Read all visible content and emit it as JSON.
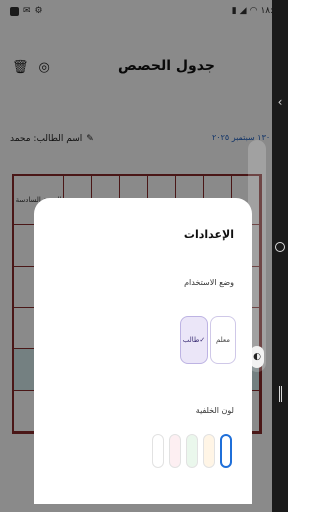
{
  "status_bar": {
    "time": "١٨:٤",
    "left_icons": [
      "media-badge-icon",
      "mail-icon",
      "settings-icon"
    ],
    "right_icons": [
      "battery-icon",
      "signal-icon",
      "wifi-icon"
    ]
  },
  "header": {
    "title": "جدول الحصص",
    "icons": [
      "delete-icon",
      "palette-icon"
    ]
  },
  "student": {
    "label": "اسم الطالب: محمد",
    "edit_icon": "pencil-icon"
  },
  "date": "١٣٠ سبتمبر ٢٠٢٥",
  "table": {
    "first_column_header": "الحصة السادسة"
  },
  "dialog": {
    "title": "الإعدادات",
    "usage_mode_label": "وضع الاستخدام",
    "mode_options": [
      {
        "label": "طالب",
        "selected": true
      },
      {
        "label": "معلم",
        "selected": false
      }
    ],
    "background_color_label": "لون الخلفية",
    "swatches": [
      "#ffffff",
      "#fdeff2",
      "#eaf7ec",
      "#fff5e6",
      "#ffffff"
    ],
    "selected_swatch_index": 4
  },
  "colors": {
    "table_border": "#8a2b2b",
    "accent": "#1f6fd9",
    "selected_mode_bg": "#ebe6f8"
  }
}
